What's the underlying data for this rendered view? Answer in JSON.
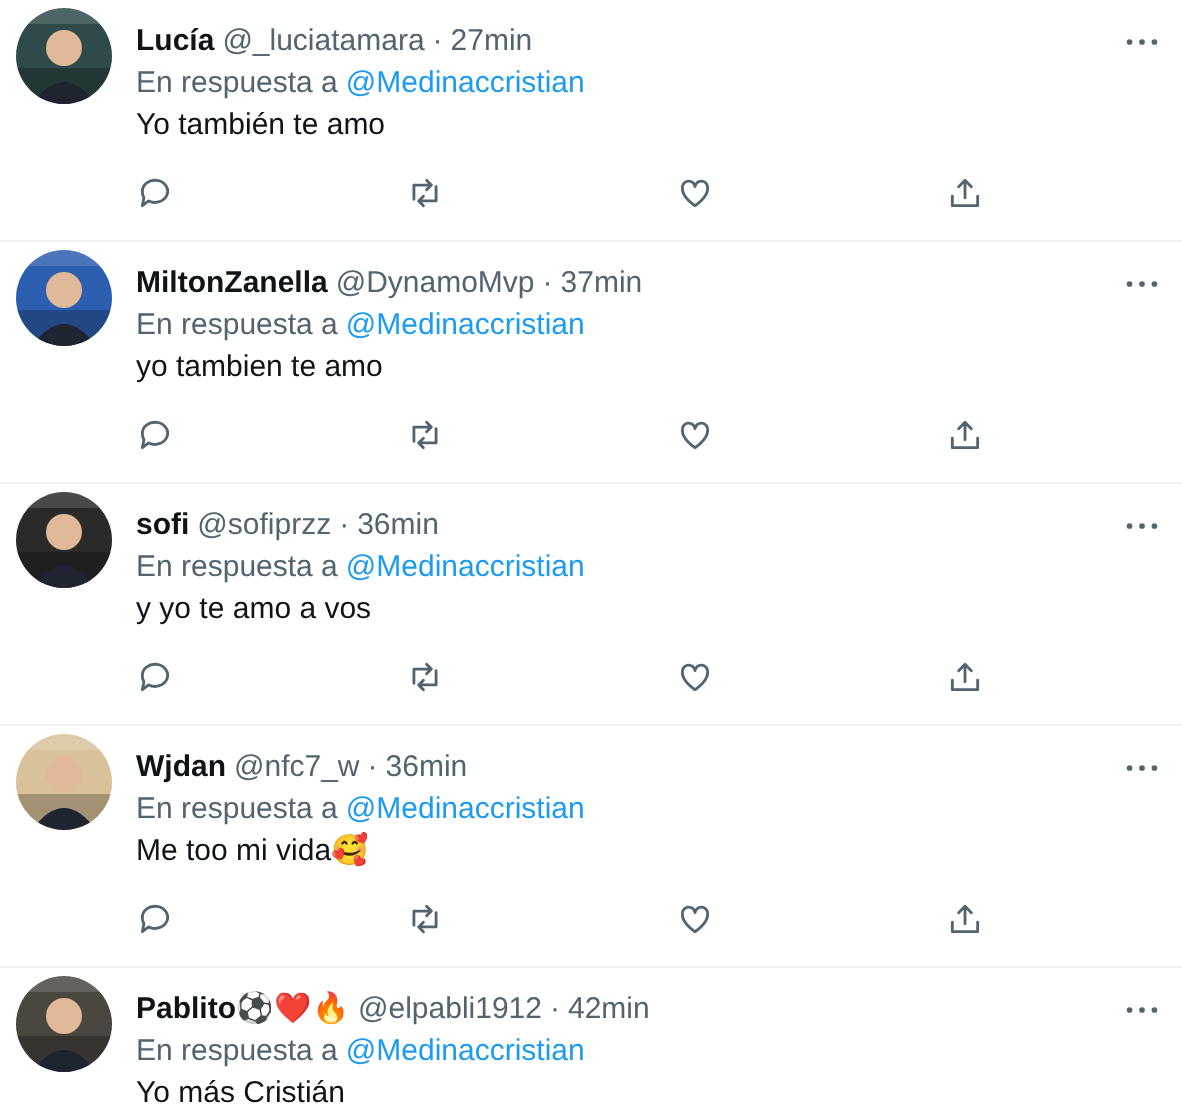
{
  "replies": [
    {
      "name": "Lucía",
      "handle": "@_luciatamara",
      "separator": "·",
      "time": "27min",
      "reply_prefix": "En respuesta a",
      "reply_to": "@Medinaccristian",
      "text": "Yo también te amo",
      "actions_shown": true
    },
    {
      "name": "MiltonZanella",
      "handle": "@DynamoMvp",
      "separator": "·",
      "time": "37min",
      "reply_prefix": "En respuesta a",
      "reply_to": "@Medinaccristian",
      "text": "yo tambien te amo",
      "actions_shown": true
    },
    {
      "name": "sofi",
      "handle": "@sofiprzz",
      "separator": "·",
      "time": "36min",
      "reply_prefix": "En respuesta a",
      "reply_to": "@Medinaccristian",
      "text": "y yo te amo a vos",
      "actions_shown": true
    },
    {
      "name": "Wjdan",
      "handle": "@nfc7_w",
      "separator": "·",
      "time": "36min",
      "reply_prefix": "En respuesta a",
      "reply_to": "@Medinaccristian",
      "text": "Me too mi vida🥰",
      "actions_shown": true
    },
    {
      "name": "Pablito⚽❤️🔥",
      "handle": "@elpabli1912",
      "separator": "·",
      "time": "42min",
      "reply_prefix": "En respuesta a",
      "reply_to": "@Medinaccristian",
      "text": "Yo más Cristián",
      "actions_shown": false
    }
  ]
}
